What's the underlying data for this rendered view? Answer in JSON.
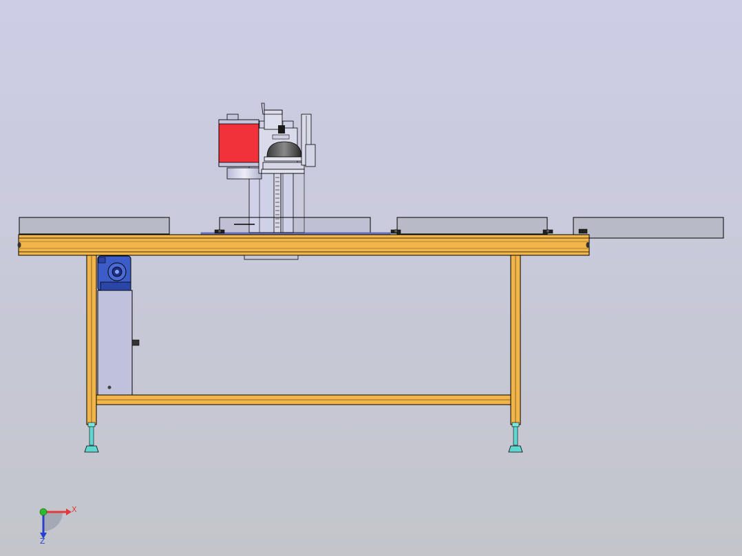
{
  "viewport": {
    "background_top": "#CDCDE6",
    "background_bottom": "#C3C5CB"
  },
  "colors": {
    "frame": "#F2B54A",
    "frame_dark": "#8A6A2A",
    "outline": "#000000",
    "panel": "#B8B9C6",
    "cabinet": "#BFC2DA",
    "motor_red": "#F2323A",
    "gearmotor_blue": "#3C5CC8",
    "feet_cyan": "#5FD6D0",
    "axis_x": "#E23A3A",
    "axis_y": "#2EBB2E",
    "axis_z": "#2B3FCF"
  },
  "triad": {
    "x_label": "X",
    "z_label": "Z"
  }
}
